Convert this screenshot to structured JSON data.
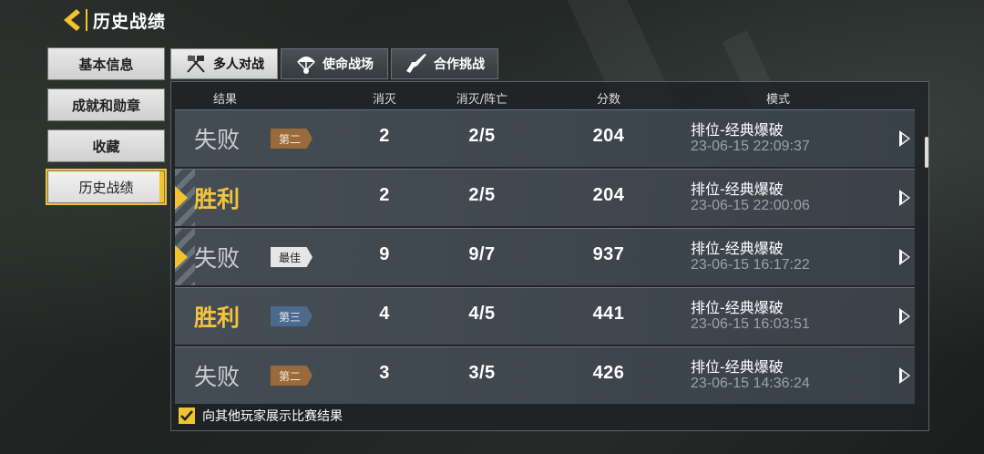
{
  "header": {
    "title": "历史战绩",
    "back_icon": "chevron-left-icon"
  },
  "sidebar": {
    "items": [
      {
        "label": "基本信息",
        "active": false
      },
      {
        "label": "成就和勋章",
        "active": false
      },
      {
        "label": "收藏",
        "active": false
      },
      {
        "label": "历史战绩",
        "active": true
      }
    ]
  },
  "tabs": [
    {
      "label": "多人对战",
      "icon": "crossed-flags-icon",
      "active": true
    },
    {
      "label": "使命战场",
      "icon": "parachute-icon",
      "active": false
    },
    {
      "label": "合作挑战",
      "icon": "rifle-icon",
      "active": false
    }
  ],
  "table": {
    "headers": [
      "结果",
      "消灭",
      "消灭/阵亡",
      "分数",
      "模式"
    ],
    "rows": [
      {
        "result": "失败",
        "win": false,
        "badge": "第二",
        "badge_style": "brown",
        "kills": "2",
        "kd": "2/5",
        "score": "204",
        "mode": "排位-经典爆破",
        "time": "23-06-15 22:09:37",
        "marked": false
      },
      {
        "result": "胜利",
        "win": true,
        "badge": "",
        "badge_style": "",
        "kills": "2",
        "kd": "2/5",
        "score": "204",
        "mode": "排位-经典爆破",
        "time": "23-06-15 22:00:06",
        "marked": true
      },
      {
        "result": "失败",
        "win": false,
        "badge": "最佳",
        "badge_style": "white",
        "kills": "9",
        "kd": "9/7",
        "score": "937",
        "mode": "排位-经典爆破",
        "time": "23-06-15 16:17:22",
        "marked": true
      },
      {
        "result": "胜利",
        "win": true,
        "badge": "第三",
        "badge_style": "blue",
        "kills": "4",
        "kd": "4/5",
        "score": "441",
        "mode": "排位-经典爆破",
        "time": "23-06-15 16:03:51",
        "marked": false
      },
      {
        "result": "失败",
        "win": false,
        "badge": "第二",
        "badge_style": "brown",
        "kills": "3",
        "kd": "3/5",
        "score": "426",
        "mode": "排位-经典爆破",
        "time": "23-06-15 14:36:24",
        "marked": false
      }
    ]
  },
  "footer": {
    "checkbox_checked": true,
    "label": "向其他玩家展示比赛结果"
  },
  "colors": {
    "accent": "#f2c230",
    "win": "#f3c33d",
    "badge_brown": "#9a6a3c",
    "badge_blue": "#4c6a8c"
  }
}
